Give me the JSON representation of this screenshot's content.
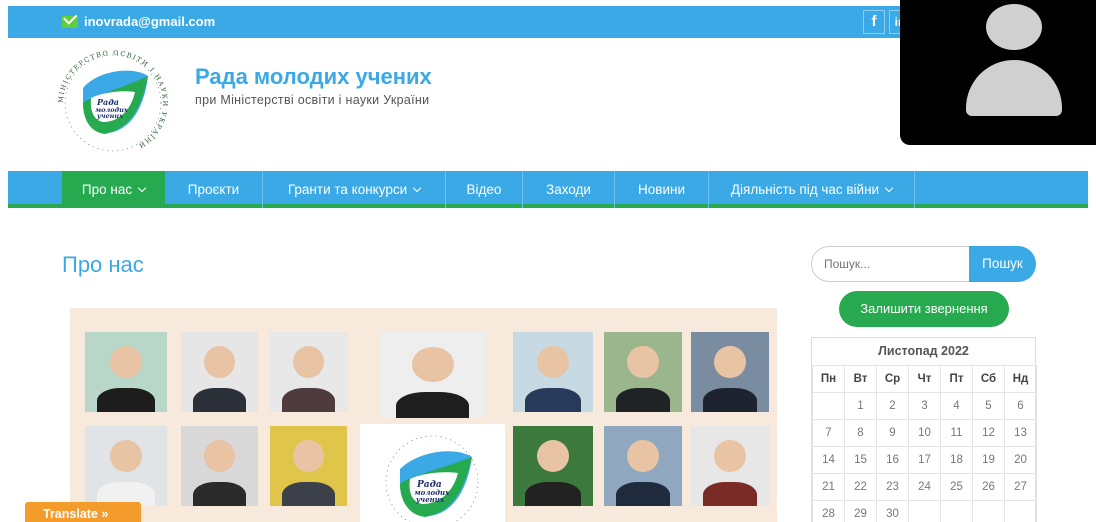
{
  "topbar": {
    "email": "inovrada@gmail.com",
    "social": [
      "f",
      "in"
    ]
  },
  "header": {
    "title": "Рада молодих учених",
    "subtitle": "при Міністерстві освіти і науки України",
    "logo_text": "Рада молодих учених",
    "logo_ring": "МІНІСТЕРСТВО ОСВІТИ І НАУКИ УКРАЇНИ"
  },
  "nav": {
    "items": [
      {
        "label": "Про нас",
        "dropdown": true,
        "active": true
      },
      {
        "label": "Проєкти",
        "dropdown": false
      },
      {
        "label": "Гранти та конкурси",
        "dropdown": true
      },
      {
        "label": "Відео",
        "dropdown": false
      },
      {
        "label": "Заходи",
        "dropdown": false
      },
      {
        "label": "Новини",
        "dropdown": false
      },
      {
        "label": "Діяльність під час війни",
        "dropdown": true
      }
    ]
  },
  "main": {
    "page_title": "Про нас"
  },
  "sidebar": {
    "search_placeholder": "Пошук...",
    "search_button": "Пошук",
    "appeal_button": "Залишити звернення",
    "calendar": {
      "title": "Листопад 2022",
      "weekdays": [
        "Пн",
        "Вт",
        "Ср",
        "Чт",
        "Пт",
        "Сб",
        "Нд"
      ],
      "weeks": [
        [
          "",
          "1",
          "2",
          "3",
          "4",
          "5",
          "6"
        ],
        [
          "7",
          "8",
          "9",
          "10",
          "11",
          "12",
          "13"
        ],
        [
          "14",
          "15",
          "16",
          "17",
          "18",
          "19",
          "20"
        ],
        [
          "21",
          "22",
          "23",
          "24",
          "25",
          "26",
          "27"
        ],
        [
          "28",
          "29",
          "30",
          "",
          "",
          "",
          ""
        ]
      ]
    }
  },
  "translate": {
    "label": "Translate »"
  },
  "colors": {
    "brand_blue": "#3aa9e6",
    "brand_green": "#27a94f",
    "translate_orange": "#f39c2c"
  }
}
